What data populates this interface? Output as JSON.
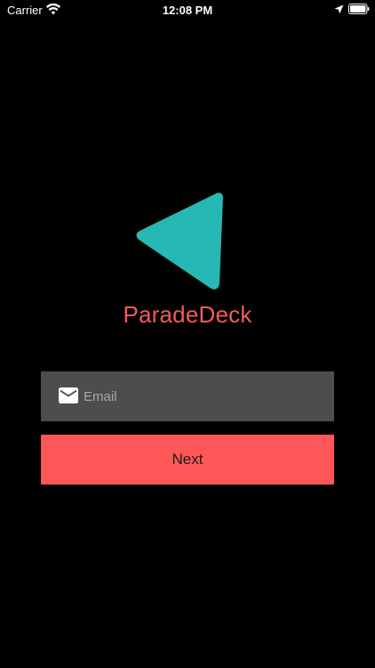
{
  "status_bar": {
    "carrier": "Carrier",
    "time": "12:08 PM",
    "wifi_icon": "wifi-icon",
    "location_icon": "location-arrow-icon",
    "battery_icon": "battery-icon"
  },
  "logo": {
    "icon": "play-triangle-logo",
    "color": "#27b8b5"
  },
  "app_name": "ParadeDeck",
  "email_field": {
    "icon": "mail-icon",
    "placeholder": "Email",
    "value": ""
  },
  "next_button": {
    "label": "Next"
  },
  "colors": {
    "background": "#000000",
    "accent": "#ff5757",
    "title": "#f05b5b",
    "field": "#4d4d4d",
    "logo": "#27b8b5"
  }
}
